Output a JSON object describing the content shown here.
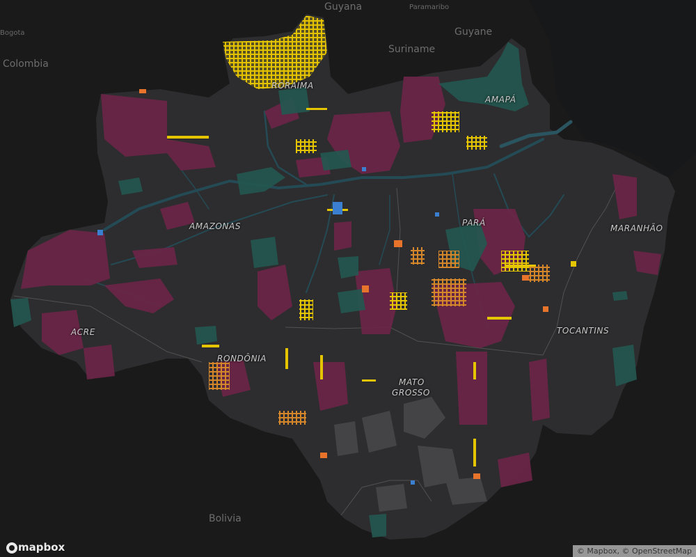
{
  "map": {
    "countries": [
      {
        "name": "Guyana"
      },
      {
        "name": "Suriname"
      },
      {
        "name": "Guyane"
      },
      {
        "name": "Colombia"
      },
      {
        "name": "Bolivia"
      }
    ],
    "cities": [
      {
        "name": "Paramaribo"
      },
      {
        "name": "Bogota"
      }
    ],
    "states": [
      {
        "name": "RORAIMA"
      },
      {
        "name": "AMAPÁ"
      },
      {
        "name": "AMAZONAS"
      },
      {
        "name": "PARÁ"
      },
      {
        "name": "MARANHÃO"
      },
      {
        "name": "ACRE"
      },
      {
        "name": "RONDÔNIA"
      },
      {
        "name": "TOCANTINS"
      },
      {
        "name": "MATO"
      },
      {
        "name": "GROSSO"
      }
    ],
    "layer_colors": {
      "background": "#1a1a1a",
      "region": "#2d2d2f",
      "indigenous_land": "#6b2547",
      "protected_area": "#23574f",
      "mining_claims": "#e5c400",
      "alert_orange": "#e8732a",
      "alert_blue": "#3a7fd0",
      "rivers": "#244b55"
    }
  },
  "branding": {
    "logo_text": "mapbox",
    "logo_icon": "mapbox-logo-icon"
  },
  "attribution": "© Mapbox, © OpenStreetMap"
}
